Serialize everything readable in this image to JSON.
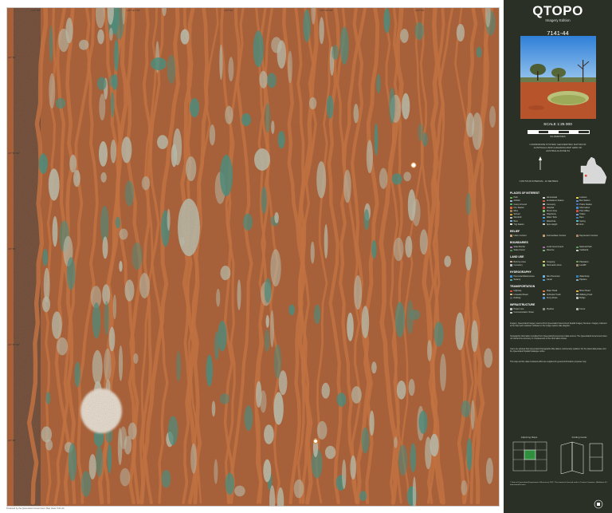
{
  "brand": {
    "title": "QTOPO",
    "subtitle": "Imagery Edition",
    "map_number": "7141-44"
  },
  "scale": {
    "label": "SCALE 1:25 000",
    "units": "KILOMETRES"
  },
  "projection": {
    "lines": [
      "COORDINATE SYSTEM: GEOCENTRIC DATUM OF",
      "AUSTRALIA 2020 (GDA2020) MAP GRID OF",
      "AUSTRALIA ZONE 54",
      "CONTOUR INTERVAL: 10 METRES"
    ]
  },
  "legend": {
    "sections": [
      {
        "id": "places",
        "heading": "PLACES OF INTEREST",
        "items": [
          {
            "label": "Park",
            "color": "#6fae4f"
          },
          {
            "label": "Homestead",
            "color": "#d9d9d9"
          },
          {
            "label": "Lookout",
            "color": "#e8d44a"
          },
          {
            "label": "Airfield",
            "color": "#9fb6d8"
          },
          {
            "label": "Ambulance Station",
            "color": "#e05a4e"
          },
          {
            "label": "Bus Station",
            "color": "#5a8fd6"
          },
          {
            "label": "Camp Ground",
            "color": "#5ab36b"
          },
          {
            "label": "Cemetery",
            "color": "#bfbfbf"
          },
          {
            "label": "Police Station",
            "color": "#4a6fc2"
          },
          {
            "label": "Fire Station",
            "color": "#e0663a"
          },
          {
            "label": "Hospital",
            "color": "#e04848"
          },
          {
            "label": "Information",
            "color": "#3c8ccf"
          },
          {
            "label": "Mine",
            "color": "#a37b52"
          },
          {
            "label": "Picnic Area",
            "color": "#7cc16a"
          },
          {
            "label": "Post Office",
            "color": "#d64a4a"
          },
          {
            "label": "School",
            "color": "#d8a23a"
          },
          {
            "label": "Telephone",
            "color": "#8e8e8e"
          },
          {
            "label": "Toilets",
            "color": "#6ea0d8"
          },
          {
            "label": "Windmill",
            "color": "#c0c0c0"
          },
          {
            "label": "Water Tank",
            "color": "#4aa8d8"
          },
          {
            "label": "Dam",
            "color": "#3a7fbf"
          },
          {
            "label": "Bore",
            "color": "#7fb1e0"
          },
          {
            "label": "Waterhole",
            "color": "#2f6fae"
          },
          {
            "label": "Spring",
            "color": "#5ac0d8"
          },
          {
            "label": "Trig Station",
            "color": "#e8e8e8"
          },
          {
            "label": "Spot Height",
            "color": "#d0d0d0"
          },
          {
            "label": "Ruin",
            "color": "#9a8a7a"
          }
        ]
      },
      {
        "id": "relief",
        "heading": "RELIEF",
        "items": [
          {
            "label": "Index Contour",
            "color": "#c9a27a"
          },
          {
            "label": "Intermediate Contour",
            "color": "#bf9a73"
          },
          {
            "label": "Depression Contour",
            "color": "#a88665"
          }
        ]
      },
      {
        "id": "boundaries",
        "heading": "BOUNDARIES",
        "items": [
          {
            "label": "State Border",
            "color": "#c07ac0"
          },
          {
            "label": "Local Government",
            "color": "#b06ab0"
          },
          {
            "label": "National Park",
            "color": "#5aa05a"
          },
          {
            "label": "State Forest",
            "color": "#4c8e4c"
          },
          {
            "label": "Reserve",
            "color": "#7ab07a"
          },
          {
            "label": "Cadastral",
            "color": "#c8c8c8"
          }
        ]
      },
      {
        "id": "land-use",
        "heading": "LAND USE",
        "items": [
          {
            "label": "Built Up Area",
            "color": "#d6b0a0"
          },
          {
            "label": "Cropping",
            "color": "#d8c86a"
          },
          {
            "label": "Plantation",
            "color": "#6a9a4a"
          },
          {
            "label": "Cemetery",
            "color": "#bcbcbc"
          },
          {
            "label": "Recreation Area",
            "color": "#9ac27a"
          },
          {
            "label": "Landfill",
            "color": "#9a8a6a"
          }
        ]
      },
      {
        "id": "hydrography",
        "heading": "HYDROGRAPHY",
        "items": [
          {
            "label": "Perennial Watercourse",
            "color": "#3a8fd0"
          },
          {
            "label": "Non Perennial",
            "color": "#6fb0e0"
          },
          {
            "label": "Waterbody",
            "color": "#2f7fbf"
          },
          {
            "label": "Swamp",
            "color": "#5aa8a0"
          },
          {
            "label": "Canal",
            "color": "#4a9fd8"
          },
          {
            "label": "Pipeline",
            "color": "#8fa8c0"
          }
        ]
      },
      {
        "id": "transportation",
        "heading": "TRANSPORTATION",
        "items": [
          {
            "label": "Highway",
            "color": "#d84a3a"
          },
          {
            "label": "Major Road",
            "color": "#e07a3a"
          },
          {
            "label": "Minor Road",
            "color": "#e8b04a"
          },
          {
            "label": "Unsealed Road",
            "color": "#d8c08a"
          },
          {
            "label": "Vehicular Track",
            "color": "#bcbcbc"
          },
          {
            "label": "Walking Track",
            "color": "#a0a0a0"
          },
          {
            "label": "Railway",
            "color": "#505050"
          },
          {
            "label": "Ferry Route",
            "color": "#4a8fd0"
          },
          {
            "label": "Bridge",
            "color": "#c0c0c0"
          }
        ]
      },
      {
        "id": "infrastructure",
        "heading": "INFRASTRUCTURE",
        "items": [
          {
            "label": "Power Line",
            "color": "#c0c0c0"
          },
          {
            "label": "Pipeline",
            "color": "#8a8a8a"
          },
          {
            "label": "Fence",
            "color": "#b0b0b0"
          },
          {
            "label": "Communication Tower",
            "color": "#d0d0d0"
          }
        ]
      }
    ]
  },
  "notes": {
    "paragraphs": [
      "Imagery: Queensland Imagery sourced from Queensland Government Spatial Imagery Services. Imagery collected at the date and resolution indicated on the image capture date diagram.",
      "Topographic information compiled from Queensland Government data sources. The Queensland Government does not warrant the accuracy or completeness of the information shown.",
      "Users are advised that Queensland Topographic Map data is continuously updated. For the latest data please visit the Queensland Spatial Catalogue online.",
      "This map and the data contained within are supplied for general information purposes only."
    ],
    "diagram_labels": [
      "Adjoining Maps",
      "Folding Guide"
    ],
    "footer": "© State of Queensland (Department of Resources) 2021. This material is licensed under a Creative Commons - Attribution 4.0 International licence.",
    "bottom": "Produced by the Queensland Government. Map sheet 7141-44."
  },
  "map": {
    "ticks_top": [
      "137°45'",
      "137°47'30\"",
      "137°50'",
      "137°52'30\"",
      "137°55'"
    ],
    "ticks_side": [
      "22°30'",
      "22°32'30\"",
      "22°35'",
      "22°37'30\"",
      "22°40'"
    ]
  },
  "colors": {
    "sidebar_bg": "#2a3026",
    "terrain_base": "#a85d36",
    "claypan": "#b9c3b6",
    "water_teal": "#3e8f84",
    "dune_crest": "#c8713e"
  }
}
